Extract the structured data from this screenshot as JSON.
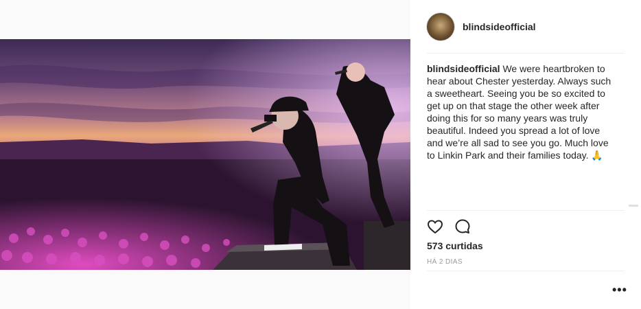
{
  "post": {
    "username": "blindsideofficial",
    "caption_username": "blindsideofficial",
    "caption_text": "We were heartbroken to hear about Chester yesterday. Always such a sweetheart. Seeing you be so excited to get up on that stage the other week after doing this for so many years was truly beautiful. Indeed you spread a lot of love and we’re all sad to see you go. Much love to Linkin Park and their families today. 🙏",
    "likes": "573 curtidas",
    "time": "HÁ 2 DIAS",
    "more_label": "•••"
  },
  "icons": {
    "like": "heart-icon",
    "comment": "comment-icon",
    "more": "more-options-icon"
  },
  "colors": {
    "text": "#262626",
    "muted": "#999999",
    "divider": "#efefef",
    "background": "#fafafa",
    "stage_pink": "#e040c8"
  }
}
